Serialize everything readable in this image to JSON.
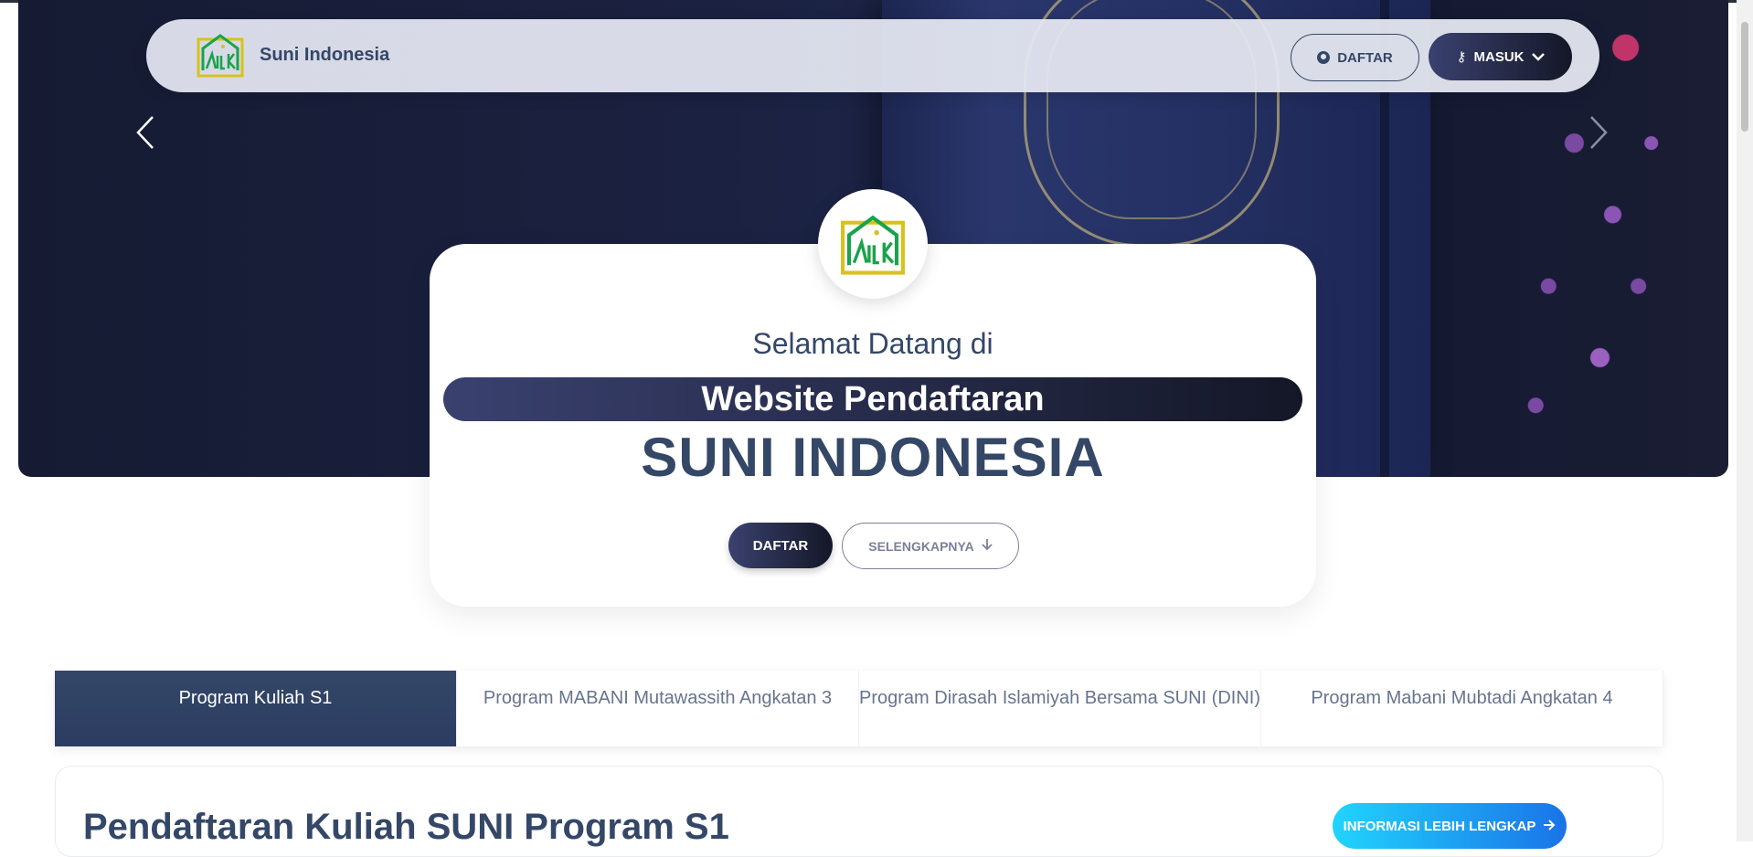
{
  "navbar": {
    "brand": "Suni Indonesia",
    "daftar_label": "DAFTAR",
    "masuk_label": "MASUK",
    "daftar_icon": "user-circle-icon",
    "masuk_icon": "key-icon",
    "masuk_dropdown_icon": "chevron-down-icon"
  },
  "carousel": {
    "prev_icon": "chevron-left-icon",
    "next_icon": "chevron-right-icon"
  },
  "hero": {
    "welcome": "Selamat Datang di",
    "subtitle": "Website Pendaftaran",
    "title": "SUNI INDONESIA",
    "daftar_button": "DAFTAR",
    "more_button": "SELENGKAPNYA",
    "more_icon": "arrow-down-icon"
  },
  "tabs": [
    {
      "label": "Program Kuliah S1",
      "active": true
    },
    {
      "label": "Program MABANI Mutawassith Angkatan 3",
      "active": false
    },
    {
      "label": "Program Dirasah Islamiyah Bersama SUNI (DINI)",
      "active": false
    },
    {
      "label": "Program Mabani Mubtadi Angkatan 4",
      "active": false
    }
  ],
  "section": {
    "title": "Pendaftaran Kuliah SUNI Program S1",
    "info_button": "INFORMASI LEBIH LENGKAP",
    "info_icon": "arrow-right-icon"
  },
  "colors": {
    "primary": "#344767",
    "dark_gradient_start": "#3a416f",
    "dark_gradient_end": "#141727",
    "info_gradient_start": "#21d4fd",
    "info_gradient_end": "#1a73e8",
    "logo_green": "#1aa34a",
    "logo_yellow": "#d8c21a"
  }
}
